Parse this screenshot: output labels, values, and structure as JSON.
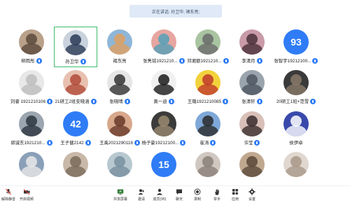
{
  "banner": {
    "text": "正在讲话: 孙卫华; 褚东亮;"
  },
  "participants": [
    {
      "name": "柳雨彤",
      "row": 0,
      "col": 0,
      "avatar_color": "#b9a18a",
      "avatar_color2": "#5b4a3c",
      "mic": true
    },
    {
      "name": "孙卫华",
      "row": 0,
      "col": 1,
      "avatar_color": "#c9d2dd",
      "avatar_color2": "#2a3a55",
      "mic": true,
      "active": true
    },
    {
      "name": "褚东亮",
      "row": 0,
      "col": 2,
      "avatar_color": "#8fb6d8",
      "avatar_color2": "#e0a060",
      "mic": false
    },
    {
      "name": "张隽铭1921210...",
      "row": 0,
      "col": 3,
      "avatar_color": "#e7a6a0",
      "avatar_color2": "#55a0b8",
      "mic": true
    },
    {
      "name": "邓湘丽1921210...",
      "row": 0,
      "col": 4,
      "avatar_color": "#a9c4a0",
      "avatar_color2": "#6b6b6b",
      "mic": true
    },
    {
      "name": "李清月",
      "row": 0,
      "col": 5,
      "avatar_color": "#c99aa8",
      "avatar_color2": "#4a3038",
      "mic": true
    },
    {
      "name": "张智宇19212100...",
      "row": 0,
      "col": 6,
      "avatar_text": "93",
      "avatar_color": "#2f7cf6",
      "mic": true
    },
    {
      "name": "刘睿 1921210106",
      "row": 1,
      "col": 0,
      "avatar_color": "#e8e8e8",
      "avatar_color2": "#bdbdbd",
      "mic": true
    },
    {
      "name": "21研工2班安晓涵",
      "row": 1,
      "col": 1,
      "avatar_color": "#e8c0b0",
      "avatar_color2": "#b04a3a",
      "mic": true
    },
    {
      "name": "张晓晴",
      "row": 1,
      "col": 2,
      "avatar_color": "#e6e6e6",
      "avatar_color2": "#333333",
      "mic": true
    },
    {
      "name": "黄一迪",
      "row": 1,
      "col": 3,
      "avatar_color": "#f0f0f0",
      "avatar_color2": "#1a1a1a",
      "mic": true
    },
    {
      "name": "王璐1921210085",
      "row": 1,
      "col": 4,
      "avatar_color": "#f2d23c",
      "avatar_color2": "#c0392b",
      "mic": true
    },
    {
      "name": "张清轩",
      "row": 1,
      "col": 5,
      "avatar_color": "#9aa4ad",
      "avatar_color2": "#4d5660",
      "mic": true
    },
    {
      "name": "20研工1班+范雪",
      "row": 1,
      "col": 6,
      "avatar_color": "#3a3a3a",
      "avatar_color2": "#8a7a6a",
      "mic": true
    },
    {
      "name": "郭诚东1921210...",
      "row": 2,
      "col": 0,
      "avatar_color": "#9ba6b0",
      "avatar_color2": "#2d3640",
      "mic": true
    },
    {
      "name": "王子健2142",
      "row": 2,
      "col": 1,
      "avatar_text": "42",
      "avatar_color": "#2f7cf6",
      "mic": true
    },
    {
      "name": "王禹2021290118",
      "row": 2,
      "col": 2,
      "avatar_color": "#d8a88c",
      "avatar_color2": "#6a3a2a",
      "mic": true
    },
    {
      "name": "杨子豪19212100...",
      "row": 2,
      "col": 3,
      "avatar_color": "#3b3b3b",
      "avatar_color2": "#9a8a70",
      "mic": true
    },
    {
      "name": "崔涛",
      "row": 2,
      "col": 4,
      "avatar_color": "#7ea8d8",
      "avatar_color2": "#2a2a2a",
      "mic": true
    },
    {
      "name": "许莹",
      "row": 2,
      "col": 5,
      "avatar_color": "#d8c0b8",
      "avatar_color2": "#3a2a2a",
      "mic": true
    },
    {
      "name": "侯伊卓",
      "row": 2,
      "col": 6,
      "avatar_color": "#3949ab",
      "avatar_color2": "#ffffff",
      "mic": false
    },
    {
      "name": "",
      "row": 3,
      "col": 0,
      "avatar_color": "#8aa0b8",
      "avatar_color2": "#e8e8e8",
      "mic": false
    },
    {
      "name": "",
      "row": 3,
      "col": 1,
      "avatar_color": "#c8b8a8",
      "avatar_color2": "#7a6a5a",
      "mic": false
    },
    {
      "name": "",
      "row": 3,
      "col": 2,
      "avatar_color": "#b8c8d0",
      "avatar_color2": "#7890a0",
      "mic": false
    },
    {
      "name": "",
      "row": 3,
      "col": 3,
      "avatar_text": "15",
      "avatar_color": "#2f7cf6",
      "mic": false
    },
    {
      "name": "",
      "row": 3,
      "col": 4,
      "avatar_color": "#d0c8c0",
      "avatar_color2": "#8a8078",
      "mic": false
    },
    {
      "name": "",
      "row": 3,
      "col": 5,
      "avatar_color": "#c0a890",
      "avatar_color2": "#5a4838",
      "mic": false
    },
    {
      "name": "",
      "row": 3,
      "col": 6,
      "avatar_color": "#e0d8d0",
      "avatar_color2": "#a89888",
      "mic": false
    }
  ],
  "toolbar": {
    "mute_label": "解除静音",
    "video_label": "开启视频",
    "share_label": "共享屏幕",
    "invite_label": "邀请",
    "members_label": "成员(95)",
    "chat_label": "聊天",
    "record_label": "录制",
    "raise_hand_label": "举手",
    "apps_label": "应用",
    "settings_label": "设置"
  },
  "colors": {
    "accent": "#2f7cf6",
    "active_border": "#3dbd6a"
  }
}
